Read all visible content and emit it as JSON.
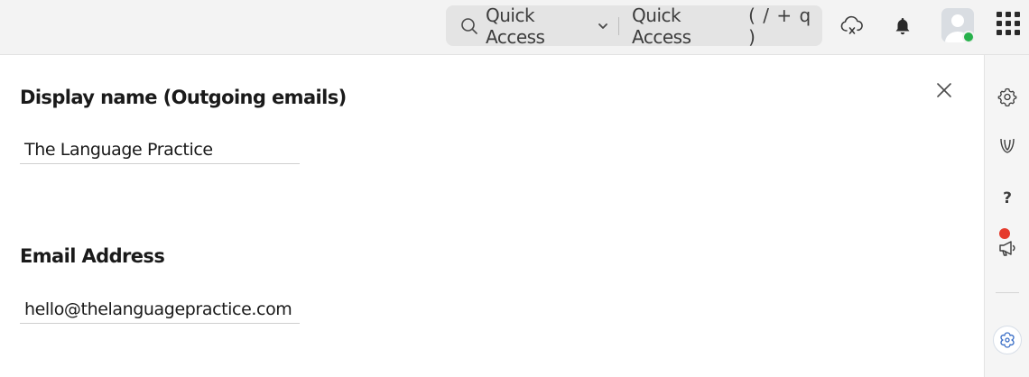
{
  "topbar": {
    "search": {
      "label": "Quick Access",
      "hint": "Quick Access",
      "shortcut": "( / + q )"
    },
    "icons": [
      "cloud-sync-icon",
      "bell-icon",
      "avatar",
      "apps-grid-icon"
    ]
  },
  "rail": {
    "icons": [
      "settings-icon",
      "feather-logo-icon",
      "help-icon",
      "announcement-icon",
      "bot-icon"
    ],
    "help_label": "?",
    "notification_dot_color": "#e53b2c"
  },
  "form": {
    "display_name": {
      "heading": "Display name (Outgoing emails)",
      "value": "The Language Practice"
    },
    "email": {
      "heading": "Email Address",
      "value": "hello@thelanguagepractice.com"
    }
  },
  "colors": {
    "topbar_bg": "#f3f3f3",
    "search_bg": "#e4e4e4",
    "status_online": "#27b14c"
  }
}
